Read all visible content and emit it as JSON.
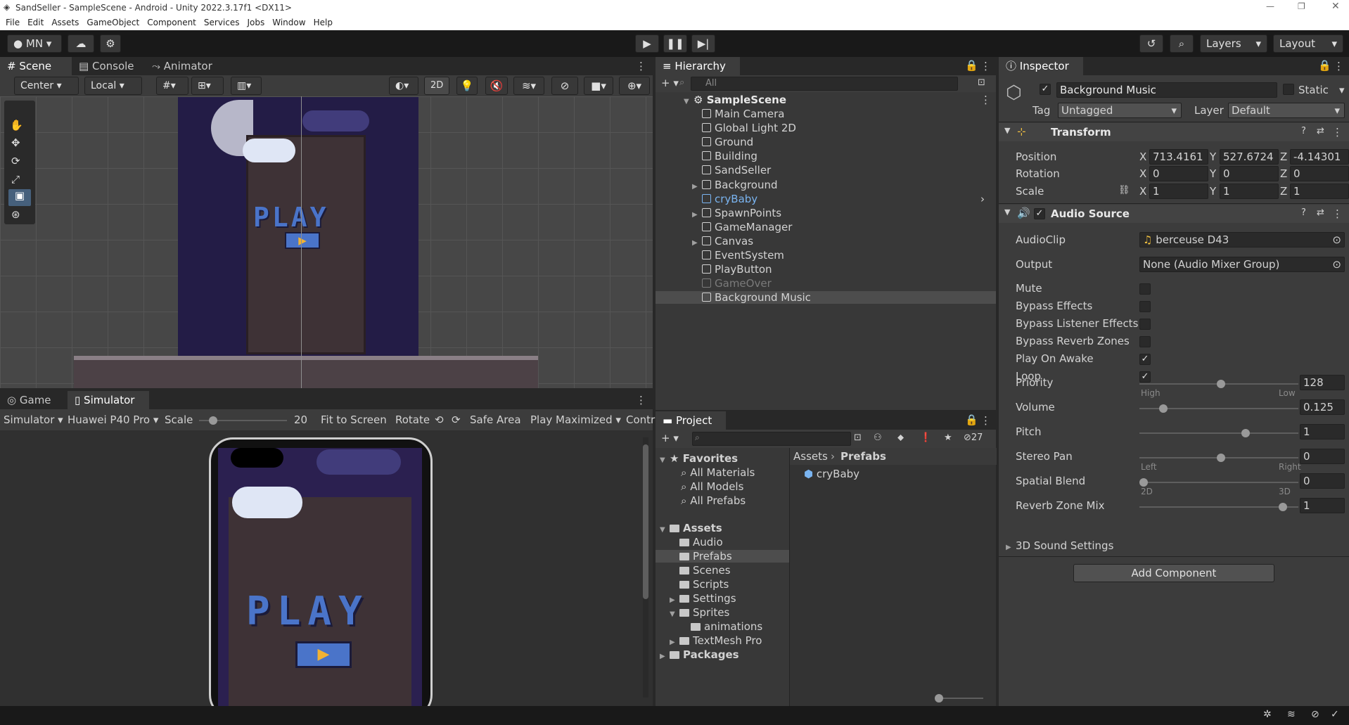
{
  "window": {
    "title": "SandSeller - SampleScene - Android - Unity 2022.3.17f1 <DX11>"
  },
  "menu": [
    "File",
    "Edit",
    "Assets",
    "GameObject",
    "Component",
    "Services",
    "Jobs",
    "Window",
    "Help"
  ],
  "toolbar": {
    "account": "MN",
    "layers": "Layers",
    "layout": "Layout"
  },
  "scene_tabs": [
    "Scene",
    "Console",
    "Animator"
  ],
  "scene_toolbar": {
    "pivot": "Center",
    "space": "Local",
    "mode2d": "2D"
  },
  "game_tabs": [
    "Game",
    "Simulator"
  ],
  "sim_toolbar": {
    "mode": "Simulator",
    "device": "Huawei P40 Pro",
    "scale_label": "Scale",
    "scale_value": "20",
    "fit": "Fit to Screen",
    "rotate": "Rotate",
    "safe": "Safe Area",
    "play": "Play Maximized",
    "extra": "Contr"
  },
  "scene_art": {
    "play_text": "PLAY"
  },
  "hierarchy": {
    "tab": "Hierarchy",
    "search": "All",
    "scene": "SampleScene",
    "items": [
      {
        "label": "Main Camera",
        "arrow": ""
      },
      {
        "label": "Global Light 2D",
        "arrow": ""
      },
      {
        "label": "Ground",
        "arrow": ""
      },
      {
        "label": "Building",
        "arrow": ""
      },
      {
        "label": "SandSeller",
        "arrow": ""
      },
      {
        "label": "Background",
        "arrow": "▶"
      },
      {
        "label": "cryBaby",
        "arrow": ""
      },
      {
        "label": "SpawnPoints",
        "arrow": "▶"
      },
      {
        "label": "GameManager",
        "arrow": ""
      },
      {
        "label": "Canvas",
        "arrow": "▶"
      },
      {
        "label": "EventSystem",
        "arrow": ""
      },
      {
        "label": "PlayButton",
        "arrow": ""
      },
      {
        "label": "GameOver",
        "arrow": ""
      },
      {
        "label": "Background Music",
        "arrow": ""
      }
    ]
  },
  "project": {
    "tab": "Project",
    "count": "27",
    "favorites": "Favorites",
    "fav_items": [
      "All Materials",
      "All Models",
      "All Prefabs"
    ],
    "assets": "Assets",
    "asset_items": [
      {
        "label": "Audio",
        "arrow": ""
      },
      {
        "label": "Prefabs",
        "arrow": ""
      },
      {
        "label": "Scenes",
        "arrow": ""
      },
      {
        "label": "Scripts",
        "arrow": ""
      },
      {
        "label": "Settings",
        "arrow": "▶"
      },
      {
        "label": "Sprites",
        "arrow": "▼"
      }
    ],
    "sprite_child": "animations",
    "tmp": "TextMesh Pro",
    "packages": "Packages",
    "breadcrumb": [
      "Assets",
      "Prefabs"
    ],
    "file": "cryBaby"
  },
  "inspector": {
    "tab": "Inspector",
    "name": "Background Music",
    "static": "Static",
    "tag_label": "Tag",
    "tag": "Untagged",
    "layer_label": "Layer",
    "layer": "Default",
    "transform": {
      "title": "Transform",
      "position_label": "Position",
      "rotation_label": "Rotation",
      "scale_label": "Scale",
      "position": [
        "713.4161",
        "527.6724",
        "-4.14301"
      ],
      "rotation": [
        "0",
        "0",
        "0"
      ],
      "scale": [
        "1",
        "1",
        "1"
      ]
    },
    "audio": {
      "title": "Audio Source",
      "clip_label": "AudioClip",
      "clip": "berceuse D43",
      "output_label": "Output",
      "output": "None (Audio Mixer Group)",
      "toggles": [
        {
          "label": "Mute",
          "checked": false
        },
        {
          "label": "Bypass Effects",
          "checked": false
        },
        {
          "label": "Bypass Listener Effects",
          "checked": false
        },
        {
          "label": "Bypass Reverb Zones",
          "checked": false
        },
        {
          "label": "Play On Awake",
          "checked": true
        },
        {
          "label": "Loop",
          "checked": true
        }
      ],
      "sliders": [
        {
          "label": "Priority",
          "value": "128",
          "pos": 0.5,
          "left": "High",
          "right": "Low"
        },
        {
          "label": "Volume",
          "value": "0.125",
          "pos": 0.125,
          "left": "",
          "right": ""
        },
        {
          "label": "Pitch",
          "value": "1",
          "pos": 0.66,
          "left": "",
          "right": ""
        },
        {
          "label": "Stereo Pan",
          "value": "0",
          "pos": 0.5,
          "left": "Left",
          "right": "Right"
        },
        {
          "label": "Spatial Blend",
          "value": "0",
          "pos": 0,
          "left": "2D",
          "right": "3D"
        },
        {
          "label": "Reverb Zone Mix",
          "value": "1",
          "pos": 0.9,
          "left": "",
          "right": ""
        }
      ],
      "sound3d": "3D Sound Settings"
    },
    "add_component": "Add Component"
  }
}
